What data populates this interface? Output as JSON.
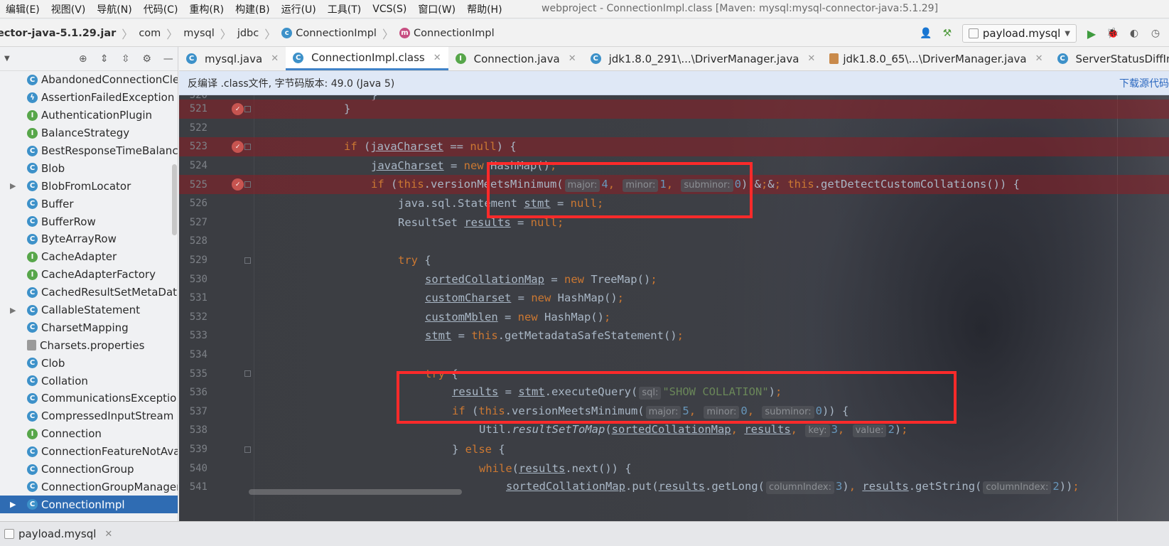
{
  "menu": [
    "编辑(E)",
    "视图(V)",
    "导航(N)",
    "代码(C)",
    "重构(R)",
    "构建(B)",
    "运行(U)",
    "工具(T)",
    "VCS(S)",
    "窗口(W)",
    "帮助(H)"
  ],
  "window_title": "webproject - ConnectionImpl.class [Maven: mysql:mysql-connector-java:5.1.29]",
  "breadcrumb": {
    "jar": "ector-java-5.1.29.jar",
    "items": [
      "com",
      "mysql",
      "jdbc",
      "ConnectionImpl",
      "ConnectionImpl"
    ]
  },
  "run_config": "payload.mysql",
  "tabs": [
    {
      "label": "mysql.java",
      "icon": "c"
    },
    {
      "label": "ConnectionImpl.class",
      "icon": "c"
    },
    {
      "label": "Connection.java",
      "icon": "i"
    },
    {
      "label": "jdk1.8.0_291\\...\\DriverManager.java",
      "icon": "c"
    },
    {
      "label": "jdk1.8.0_65\\...\\DriverManager.java",
      "icon": "jar"
    },
    {
      "label": "ServerStatusDiffIntercepto",
      "icon": "c"
    }
  ],
  "notice": {
    "text": "反编译 .class文件, 字节码版本: 49.0 (Java 5)",
    "link": "下载源代码"
  },
  "tree": [
    {
      "label": "AbandonedConnectionCle",
      "icon": "c"
    },
    {
      "label": "AssertionFailedException",
      "icon": "e"
    },
    {
      "label": "AuthenticationPlugin",
      "icon": "i"
    },
    {
      "label": "BalanceStrategy",
      "icon": "i"
    },
    {
      "label": "BestResponseTimeBalance",
      "icon": "c"
    },
    {
      "label": "Blob",
      "icon": "c"
    },
    {
      "label": "BlobFromLocator",
      "icon": "c"
    },
    {
      "label": "Buffer",
      "icon": "c"
    },
    {
      "label": "BufferRow",
      "icon": "c"
    },
    {
      "label": "ByteArrayRow",
      "icon": "c"
    },
    {
      "label": "CacheAdapter",
      "icon": "i"
    },
    {
      "label": "CacheAdapterFactory",
      "icon": "i"
    },
    {
      "label": "CachedResultSetMetaData",
      "icon": "c"
    },
    {
      "label": "CallableStatement",
      "icon": "c"
    },
    {
      "label": "CharsetMapping",
      "icon": "c"
    },
    {
      "label": "Charsets.properties",
      "icon": "props"
    },
    {
      "label": "Clob",
      "icon": "c"
    },
    {
      "label": "Collation",
      "icon": "c"
    },
    {
      "label": "CommunicationsExceptio",
      "icon": "c"
    },
    {
      "label": "CompressedInputStream",
      "icon": "c"
    },
    {
      "label": "Connection",
      "icon": "i"
    },
    {
      "label": "ConnectionFeatureNotAva",
      "icon": "c"
    },
    {
      "label": "ConnectionGroup",
      "icon": "c"
    },
    {
      "label": "ConnectionGroupManager",
      "icon": "c"
    },
    {
      "label": "ConnectionImpl",
      "icon": "c"
    }
  ],
  "code": {
    "first_partial_line": "520",
    "lines": [
      {
        "n": "521",
        "text": "}"
      },
      {
        "n": "522",
        "text": ""
      },
      {
        "n": "523",
        "text": "if (javaCharset == null) {"
      },
      {
        "n": "524",
        "text": "javaCharset = new HashMap();"
      },
      {
        "n": "525",
        "text": "if (this.versionMeetsMinimum(major: 4, minor: 1, subminor: 0) && this.getDetectCustomCollations()) {"
      },
      {
        "n": "526",
        "text": "java.sql.Statement stmt = null;"
      },
      {
        "n": "527",
        "text": "ResultSet results = null;"
      },
      {
        "n": "528",
        "text": ""
      },
      {
        "n": "529",
        "text": "try {"
      },
      {
        "n": "530",
        "text": "sortedCollationMap = new TreeMap();"
      },
      {
        "n": "531",
        "text": "customCharset = new HashMap();"
      },
      {
        "n": "532",
        "text": "customMblen = new HashMap();"
      },
      {
        "n": "533",
        "text": "stmt = this.getMetadataSafeStatement();"
      },
      {
        "n": "534",
        "text": ""
      },
      {
        "n": "535",
        "text": "try {"
      },
      {
        "n": "536",
        "text": "results = stmt.executeQuery(sql: \"SHOW COLLATION\");"
      },
      {
        "n": "537",
        "text": "if (this.versionMeetsMinimum(major: 5, minor: 0, subminor: 0)) {"
      },
      {
        "n": "538",
        "text": "Util.resultSetToMap(sortedCollationMap, results, key: 3, value: 2);"
      },
      {
        "n": "539",
        "text": "} else {"
      },
      {
        "n": "540",
        "text": "while(results.next()) {"
      },
      {
        "n": "541",
        "text": "sortedCollationMap.put(results.getLong(columnIndex: 3), results.getString(columnIndex: 2));"
      }
    ],
    "breakpoints": [
      "521",
      "523",
      "525"
    ]
  },
  "bottom_tab": "payload.mysql",
  "colors": {
    "highlight_box": "#ff2a2a",
    "breakpoint_line": "#8c1e24",
    "keyword": "#cc7832",
    "string": "#6a8759",
    "number": "#6897bb",
    "selection": "#2f6cb3"
  }
}
